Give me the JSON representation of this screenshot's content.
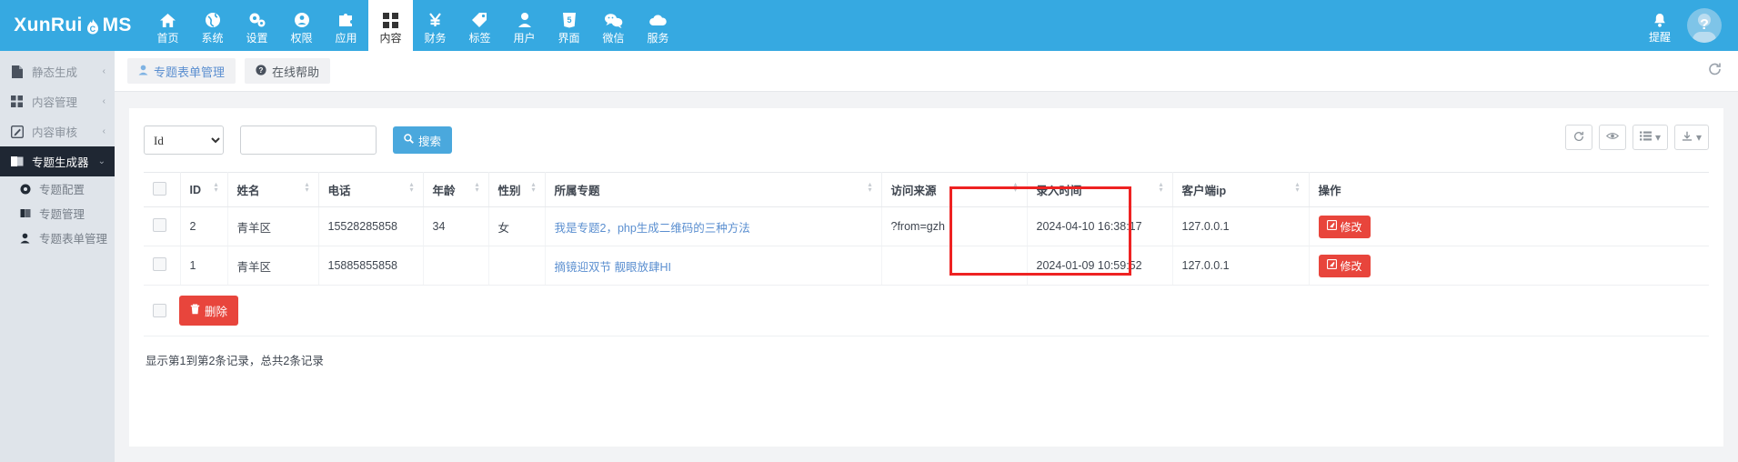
{
  "brand": {
    "text_left": "XunRui",
    "text_right": "MS",
    "flame_letter": "C"
  },
  "topnav": {
    "items": [
      {
        "label": "首页",
        "icon": "home-icon",
        "active": false
      },
      {
        "label": "系统",
        "icon": "globe-icon",
        "active": false
      },
      {
        "label": "设置",
        "icon": "gears-icon",
        "active": false
      },
      {
        "label": "权限",
        "icon": "user-circle-icon",
        "active": false
      },
      {
        "label": "应用",
        "icon": "puzzle-icon",
        "active": false
      },
      {
        "label": "内容",
        "icon": "grid-icon",
        "active": true
      },
      {
        "label": "财务",
        "icon": "yen-icon",
        "active": false
      },
      {
        "label": "标签",
        "icon": "tag-icon",
        "active": false
      },
      {
        "label": "用户",
        "icon": "user-icon",
        "active": false
      },
      {
        "label": "界面",
        "icon": "html5-icon",
        "active": false
      },
      {
        "label": "微信",
        "icon": "wechat-icon",
        "active": false
      },
      {
        "label": "服务",
        "icon": "cloud-icon",
        "active": false
      }
    ],
    "alert_label": "提醒",
    "avatar_label": "?"
  },
  "sidebar": {
    "items": [
      {
        "label": "静态生成",
        "icon": "file-icon",
        "chevron": "‹",
        "active": false
      },
      {
        "label": "内容管理",
        "icon": "grid-icon",
        "chevron": "‹",
        "active": false
      },
      {
        "label": "内容审核",
        "icon": "edit-square-icon",
        "chevron": "‹",
        "active": false
      },
      {
        "label": "专题生成器",
        "icon": "book-icon",
        "chevron": "⌄",
        "active": true
      }
    ],
    "subitems": [
      {
        "label": "专题配置",
        "icon": "gear-icon"
      },
      {
        "label": "专题管理",
        "icon": "book-icon"
      },
      {
        "label": "专题表单管理",
        "icon": "user-icon"
      }
    ]
  },
  "tabbar": {
    "tabs": [
      {
        "label": "专题表单管理",
        "icon": "user-icon",
        "style": "link"
      },
      {
        "label": "在线帮助",
        "icon": "question-circle-icon",
        "style": "plain"
      }
    ],
    "refresh_icon": "refresh-icon"
  },
  "filter": {
    "select_value": "Id",
    "select_options": [
      "Id"
    ],
    "keyword_value": "",
    "keyword_placeholder": "",
    "search_label": "搜索",
    "search_icon": "search-icon"
  },
  "toolbar": {
    "buttons": [
      {
        "icon": "refresh-icon",
        "label": ""
      },
      {
        "icon": "eye-icon",
        "label": ""
      },
      {
        "icon": "list-icon",
        "label": "",
        "caret": "▾"
      },
      {
        "icon": "download-icon",
        "label": "",
        "caret": "▾"
      }
    ]
  },
  "table": {
    "columns": [
      {
        "label": "",
        "sortable": false,
        "key": "checkbox"
      },
      {
        "label": "ID",
        "sortable": true,
        "key": "id"
      },
      {
        "label": "姓名",
        "sortable": true,
        "key": "name"
      },
      {
        "label": "电话",
        "sortable": true,
        "key": "phone"
      },
      {
        "label": "年龄",
        "sortable": true,
        "key": "age"
      },
      {
        "label": "性别",
        "sortable": true,
        "key": "gender"
      },
      {
        "label": "所属专题",
        "sortable": true,
        "key": "topic"
      },
      {
        "label": "访问来源",
        "sortable": true,
        "key": "source"
      },
      {
        "label": "录入时间",
        "sortable": true,
        "key": "created"
      },
      {
        "label": "客户端ip",
        "sortable": true,
        "key": "ip"
      },
      {
        "label": "操作",
        "sortable": false,
        "key": "action"
      }
    ],
    "rows": [
      {
        "id": "2",
        "name": "青羊区",
        "phone": "15528285858",
        "age": "34",
        "gender": "女",
        "topic": "我是专题2，php生成二维码的三种方法",
        "source": "?from=gzh",
        "created": "2024-04-10 16:38:17",
        "created_highlight": true,
        "ip": "127.0.0.1",
        "action_label": "修改",
        "action_icon": "edit-icon"
      },
      {
        "id": "1",
        "name": "青羊区",
        "phone": "15885855858",
        "age": "",
        "gender": "",
        "topic": "摘镜迎双节 靓眼放肆HI",
        "source": "",
        "created": "2024-01-09 10:59:52",
        "created_highlight": false,
        "ip": "127.0.0.1",
        "action_label": "修改",
        "action_icon": "edit-icon"
      }
    ]
  },
  "footer": {
    "delete_label": "删除",
    "delete_icon": "trash-icon",
    "record_info": "显示第1到第2条记录，总共2条记录"
  },
  "colors": {
    "brand_blue": "#36a9e1",
    "accent_blue": "#4aa8dd",
    "link_blue": "#5b8fd0",
    "danger_red": "#e8453c",
    "highlight_red": "#ee2222",
    "sidebar_bg": "#dfe4ea",
    "sidebar_active": "#1f2733"
  }
}
